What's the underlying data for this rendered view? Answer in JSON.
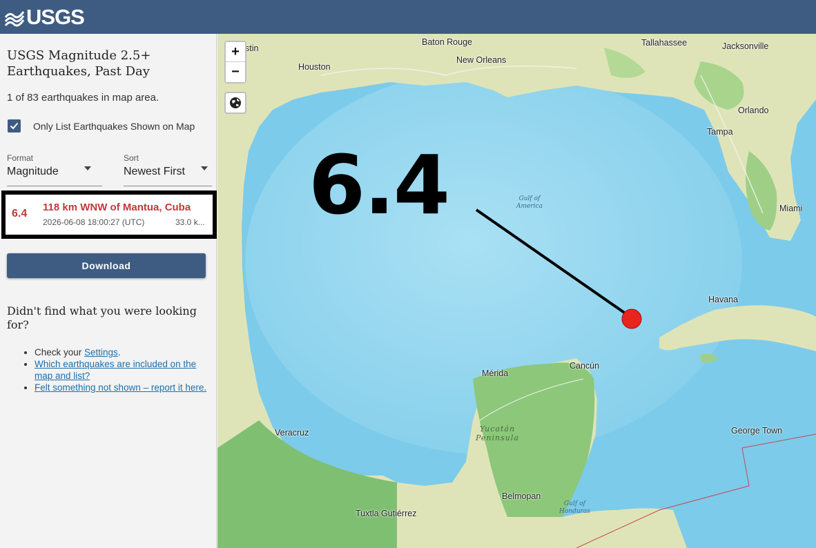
{
  "header": {
    "logo_text": "USGS"
  },
  "sidebar": {
    "title": "USGS Magnitude 2.5+ Earthquakes, Past Day",
    "count_text": "1 of 83 earthquakes in map area.",
    "only_list_label": "Only List Earthquakes Shown on Map",
    "only_list_checked": true,
    "format": {
      "label": "Format",
      "value": "Magnitude"
    },
    "sort": {
      "label": "Sort",
      "value": "Newest First"
    },
    "earthquakes": [
      {
        "magnitude": "6.4",
        "place": "118 km WNW of Mantua, Cuba",
        "time": "2026-06-08 18:00:27 (UTC)",
        "depth": "33.0 k..."
      }
    ],
    "download_label": "Download",
    "help": {
      "title": "Didn't find what you were looking for?",
      "item1_prefix": "Check your ",
      "item1_link": "Settings",
      "item1_suffix": ".",
      "item2_link": "Which earthquakes are included on the map and list?",
      "item3_link": "Felt something not shown – report it here."
    }
  },
  "map": {
    "zoom_in": "+",
    "zoom_out": "−",
    "big_magnitude": "6.4",
    "epicenter_color": "#e8241c",
    "cities": {
      "baton_rouge": "Baton Rouge",
      "houston": "Houston",
      "new_orleans": "New Orleans",
      "tallahassee": "Tallahassee",
      "jacksonville": "Jacksonville",
      "orlando": "Orlando",
      "tampa": "Tampa",
      "miami": "Miami",
      "havana": "Havana",
      "cancun": "Cancún",
      "merida": "Mérida",
      "veracruz": "Veracruz",
      "george_town": "George Town",
      "belmopan": "Belmopan",
      "tuxtla": "Tuxtla Gutiérrez",
      "stin": "stin"
    },
    "water_labels": {
      "gulf_of_america": "Gulf of\nAmerica",
      "gulf_of_honduras": "Gulf of\nHonduras"
    },
    "region_labels": {
      "yucatan": "Yucatán\nPeninsula"
    }
  }
}
